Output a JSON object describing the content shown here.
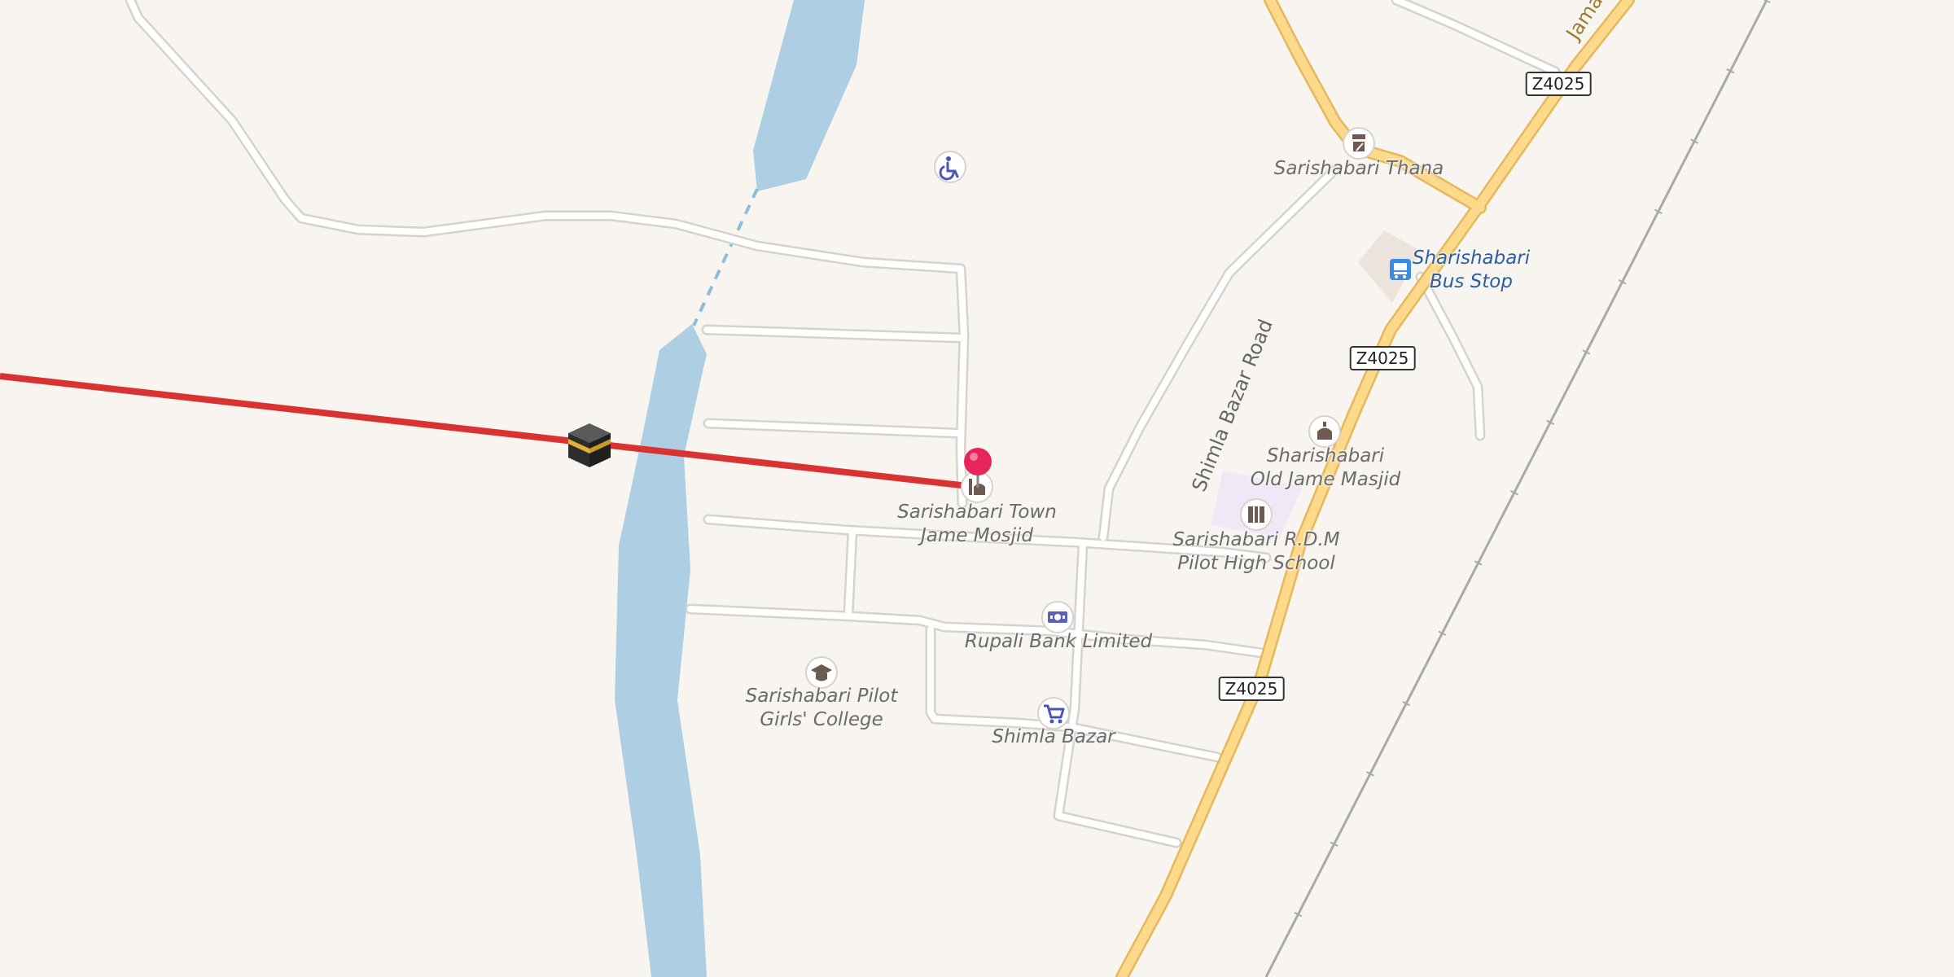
{
  "map": {
    "colors": {
      "background": "#f8f5f1",
      "water": "#aecfe3",
      "minor_road": "#ffffff",
      "minor_road_casing": "#d6d2cc",
      "primary_road": "#fcd98b",
      "primary_road_casing": "#e6b85a",
      "railway": "#a9a9a9",
      "qibla_line": "#d93232",
      "location_pin": "#e8255b",
      "poi_icon": "#6e5a50",
      "bank_icon": "#5a61b8",
      "transit_icon": "#3a8ce0",
      "school_area": "#efe9f7"
    },
    "road_shields": [
      "Z4025",
      "Z4025",
      "Z4025"
    ],
    "road_labels": {
      "shimla": "Shimla Bazar Road",
      "jamalpur": "Jamalpu"
    },
    "pois": [
      {
        "id": "thana",
        "icon": "police-icon",
        "label": "Sarishabari Thana"
      },
      {
        "id": "bus_stop",
        "icon": "bus-stop-icon",
        "label": "Sharishabari\nBus Stop"
      },
      {
        "id": "old_mosque",
        "icon": "mosque-icon",
        "label": "Sharishabari\nOld Jame Masjid"
      },
      {
        "id": "town_mosque",
        "icon": "mosque-icon",
        "label": "Sarishabari Town\nJame Mosjid"
      },
      {
        "id": "school",
        "icon": "school-icon",
        "label": "Sarishabari R.D.M\nPilot High School"
      },
      {
        "id": "bank",
        "icon": "bank-icon",
        "label": "Rupali Bank Limited"
      },
      {
        "id": "college",
        "icon": "college-icon",
        "label": "Sarishabari Pilot\nGirls' College"
      },
      {
        "id": "bazar",
        "icon": "shopping-cart-icon",
        "label": "Shimla Bazar"
      },
      {
        "id": "accessible",
        "icon": "wheelchair-icon",
        "label": ""
      }
    ],
    "markers": {
      "location_pin": "location-pin-icon",
      "qibla": "kaaba-icon"
    }
  }
}
